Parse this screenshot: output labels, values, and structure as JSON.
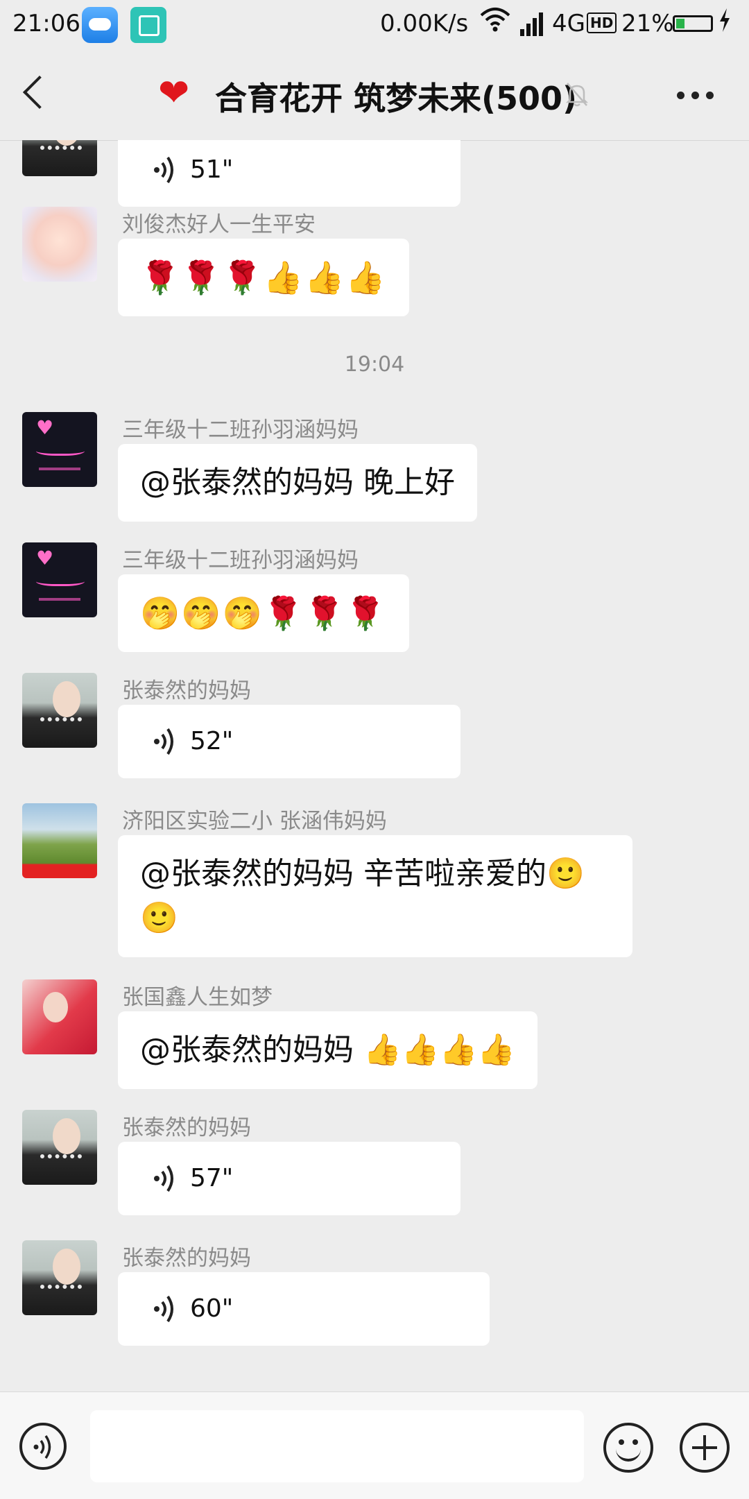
{
  "status_bar": {
    "time": "21:06",
    "net_speed": "0.00K/s",
    "network": "4G",
    "hd": "HD",
    "battery": "21%"
  },
  "nav": {
    "title": "合育花开 筑梦未来(500)",
    "icons": [
      "back-icon",
      "heart-icon",
      "mute-bell-icon",
      "more-icon"
    ]
  },
  "messages": [
    {
      "type": "voice",
      "duration": "51\""
    },
    {
      "type": "text",
      "sender": "刘俊杰好人一生平安",
      "text": "🌹🌹🌹👍👍👍"
    },
    {
      "type": "time",
      "text": "19:04"
    },
    {
      "type": "text",
      "sender": "三年级十二班孙羽涵妈妈",
      "text": "@张泰然的妈妈  晚上好"
    },
    {
      "type": "text",
      "sender": "三年级十二班孙羽涵妈妈",
      "text": "🤭🤭🤭🌹🌹🌹"
    },
    {
      "type": "voice",
      "sender": "张泰然的妈妈",
      "duration": "52\""
    },
    {
      "type": "text",
      "sender": "济阳区实验二小    张涵伟妈妈",
      "line1": "@张泰然的妈妈  辛苦啦亲爱的🙂",
      "line2": "🙂"
    },
    {
      "type": "text",
      "sender": "张国鑫人生如梦",
      "text": "@张泰然的妈妈 👍👍👍👍"
    },
    {
      "type": "voice",
      "sender": "张泰然的妈妈",
      "duration": "57\""
    },
    {
      "type": "voice",
      "sender": "张泰然的妈妈",
      "duration": "60\""
    }
  ],
  "colors": {
    "background": "#ededed",
    "bubble": "#ffffff",
    "name": "#8a8a8a",
    "heart": "#e0161c"
  }
}
